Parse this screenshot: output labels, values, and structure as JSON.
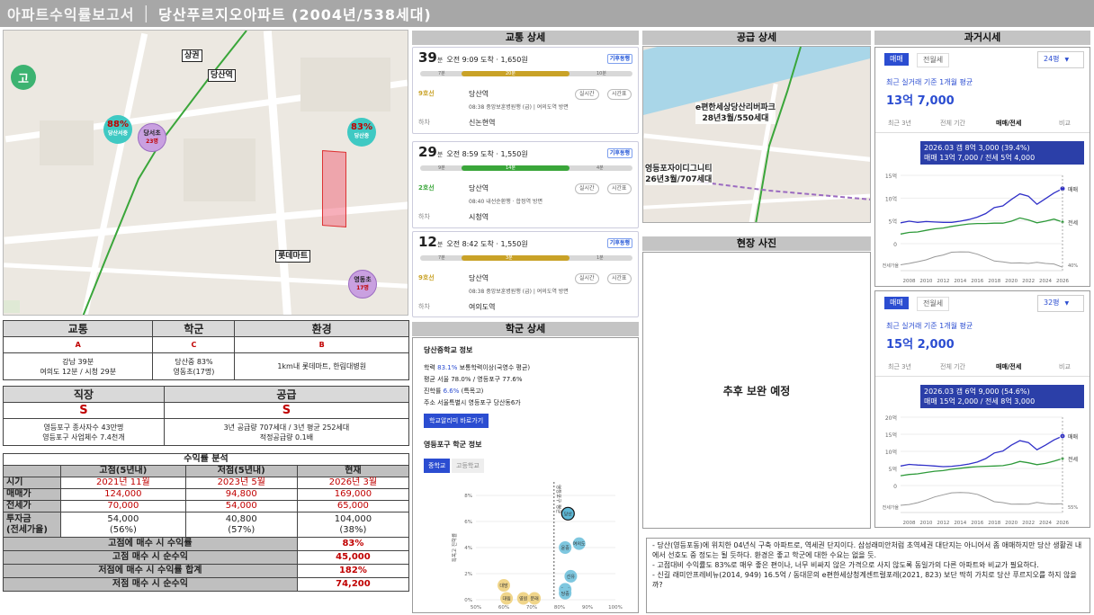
{
  "header": {
    "app": "아파트수익률보고서",
    "title": "당산푸르지오아파트 (2004년/538세대)"
  },
  "map": {
    "labels": {
      "school1": "고",
      "sangga": "상권",
      "station": "당산역",
      "mart": "롯데마트"
    },
    "schools": [
      {
        "pct": "88%",
        "name": "당산서중"
      },
      {
        "pct": "",
        "name": "당서초",
        "sub": "23명"
      },
      {
        "pct": "83%",
        "name": "당산중"
      },
      {
        "pct": "",
        "name": "영동초",
        "sub": "17명"
      }
    ]
  },
  "summary1": {
    "headers": [
      "교통",
      "학군",
      "환경"
    ],
    "grades": [
      "A",
      "C",
      "B"
    ],
    "details": [
      "강남 39분\n여의도 12분 / 시청 29분",
      "당산중 83%\n영동초(17명)",
      "1km내 롯데마트, 한림대병원"
    ]
  },
  "summary2": {
    "headers": [
      "직장",
      "공급"
    ],
    "grades": [
      "S",
      "S"
    ],
    "details": [
      "영등포구 종사자수 43만명\n영등포구 사업체수 7.4천개",
      "3년 공급량 707세대 / 3년 평균 252세대\n적정공급량 0.1배"
    ]
  },
  "profit": {
    "title": "수익률 분석",
    "cols": [
      "고점(5년내)",
      "저점(5년내)",
      "현재"
    ],
    "rows": [
      {
        "label": "시기",
        "vals": [
          "2021년 11월",
          "2023년 5월",
          "2026년 3월"
        ],
        "red": true
      },
      {
        "label": "매매가",
        "vals": [
          "124,000",
          "94,800",
          "169,000"
        ],
        "red": true
      },
      {
        "label": "전세가",
        "vals": [
          "70,000",
          "54,000",
          "65,000"
        ],
        "red": true
      },
      {
        "label": "투자금\n(전세가율)",
        "vals": [
          "54,000\n(56%)",
          "40,800\n(57%)",
          "104,000\n(38%)"
        ],
        "red": false
      }
    ],
    "summary": [
      {
        "label": "고점에 매수 시 수익률",
        "val": "83%"
      },
      {
        "label": "고점 매수 시 순수익",
        "val": "45,000"
      },
      {
        "label": "저점에 매수 시 수익률 합계",
        "val": "182%"
      },
      {
        "label": "저점 매수 시 순수익",
        "val": "74,200"
      }
    ]
  },
  "transit": {
    "title": "교통 상세",
    "routes": [
      {
        "min": "39",
        "unit": "분",
        "info": "오전 9:09 도착 · 1,650원",
        "badge": "기후동행",
        "bar": [
          "7분",
          "20분",
          "10분"
        ],
        "line": "9호선",
        "station": "당산역",
        "desc": "08:38 중앙보훈병원행 (급) | 여의도역 방면",
        "dest": "신논현역",
        "color": "#c9a227"
      },
      {
        "min": "29",
        "unit": "분",
        "info": "오전 8:59 도착 · 1,550원",
        "badge": "기후동행",
        "bar": [
          "9분",
          "14분",
          "4분"
        ],
        "line": "2호선",
        "station": "당산역",
        "desc": "08:40 내선순환행 · 합정역 방면",
        "dest": "시청역",
        "color": "#3aa63a"
      },
      {
        "min": "12",
        "unit": "분",
        "info": "오전 8:42 도착 · 1,550원",
        "badge": "기후동행",
        "bar": [
          "7분",
          "3분",
          "1분"
        ],
        "line": "9호선",
        "station": "당산역",
        "desc": "08:38 중앙보훈병원행 (급) | 여의도역 방면",
        "dest": "여의도역",
        "color": "#c9a227"
      }
    ],
    "pills": [
      "실시간",
      "시간표"
    ],
    "getoff": "하차"
  },
  "school": {
    "title": "학군 상세",
    "name": "당산중학교 정보",
    "lines": [
      {
        "k": "학력",
        "v": "83.1%",
        "rest": "보통학력이상(국영수 평균)"
      },
      {
        "k": "평균",
        "v": "서울 78.0% / 영등포구 77.6%",
        "rest": ""
      },
      {
        "k": "진학률",
        "v": "6.6%",
        "rest": "(특목고)"
      },
      {
        "k": "주소",
        "v": "서울특별시 영등포구 당산동6가",
        "rest": ""
      }
    ],
    "button": "학교알리미 바로가기",
    "subtitle": "영등포구 학군 정보",
    "tabs": [
      "중학교",
      "고등학교"
    ],
    "chart_data": {
      "type": "scatter",
      "x_ticks": [
        "50%",
        "60%",
        "70%",
        "80%",
        "90%",
        "100%"
      ],
      "y_ticks": [
        "8%",
        "6%",
        "4%",
        "2%",
        "0%"
      ],
      "xlim": [
        50,
        100
      ],
      "ylim": [
        0,
        8
      ],
      "xlabel": "학업성취도",
      "ylabel": "특목고 진학률",
      "vline_label": "영등포구 평균",
      "points": [
        {
          "name": "당산",
          "x": 83,
          "y": 6.6,
          "hl": true
        },
        {
          "name": "여의도",
          "x": 87,
          "y": 4.3,
          "hl": false
        },
        {
          "name": "윤중",
          "x": 82,
          "y": 4.0,
          "hl": false
        },
        {
          "name": "선유",
          "x": 84,
          "y": 1.8,
          "hl": false
        },
        {
          "name": "문래",
          "x": 82,
          "y": 0.8,
          "hl": false
        },
        {
          "name": "당중",
          "x": 82,
          "y": 0.5,
          "hl": false
        },
        {
          "name": "대방",
          "x": 60,
          "y": 1.1,
          "hl": false
        },
        {
          "name": "대림",
          "x": 61,
          "y": 0.1,
          "hl": false
        },
        {
          "name": "영원",
          "x": 67,
          "y": 0.1,
          "hl": false
        },
        {
          "name": "문래",
          "x": 71,
          "y": 0.1,
          "hl": false
        }
      ]
    }
  },
  "supply": {
    "title": "공급 상세",
    "labels": [
      "e편한세상당산리버파크\n28년3월/550세대",
      "영등포자이디그니티\n26년3월/707세대"
    ]
  },
  "photo": {
    "title": "현장 사진",
    "body": "추후 보완 예정"
  },
  "market": {
    "title": "과거시세",
    "panels": [
      {
        "tabs": [
          "매매",
          "전월세"
        ],
        "size": "24평",
        "avg_label": "최근 실거래 기준 1개월 평균",
        "avg": "13억 7,000",
        "periods": [
          "최근 3년",
          "전체 기간",
          "매매/전세",
          "비교"
        ],
        "tip1": "2026.03 갭 8억 3,000 (39.4%)",
        "tip2": "매매 13억 7,000 / 전세 5억 4,000",
        "chart_data": {
          "type": "line",
          "x": [
            2007,
            2008,
            2009,
            2010,
            2011,
            2012,
            2013,
            2014,
            2015,
            2016,
            2017,
            2018,
            2019,
            2020,
            2021,
            2022,
            2023,
            2024,
            2025,
            2026
          ],
          "x_ticks": [
            "2008",
            "2010",
            "2012",
            "2014",
            "2016",
            "2018",
            "2020",
            "2022",
            "2024",
            "2026"
          ],
          "y_ticks": [
            "15억",
            "10억",
            "5억",
            "0"
          ],
          "ylim": [
            0,
            17
          ],
          "series": [
            {
              "name": "매매",
              "values": [
                5.2,
                5.6,
                5.3,
                5.5,
                5.4,
                5.3,
                5.3,
                5.6,
                6.0,
                6.6,
                7.5,
                9.0,
                9.4,
                11.0,
                12.4,
                11.8,
                9.8,
                11.2,
                12.6,
                13.7
              ]
            },
            {
              "name": "전세",
              "values": [
                2.4,
                2.8,
                2.9,
                3.3,
                3.7,
                3.9,
                4.3,
                4.6,
                4.9,
                5.0,
                5.0,
                5.1,
                5.1,
                5.6,
                6.4,
                5.9,
                5.2,
                5.6,
                6.1,
                5.4
              ]
            }
          ],
          "ratio_label": "전세가율",
          "ratio_end": "40%"
        }
      },
      {
        "tabs": [
          "매매",
          "전월세"
        ],
        "size": "32평",
        "avg_label": "최근 실거래 기준 1개월 평균",
        "avg": "15억 2,000",
        "periods": [
          "최근 3년",
          "전체 기간",
          "매매/전세",
          "비교"
        ],
        "tip1": "2026.03 갭 6억 9,000 (54.6%)",
        "tip2": "매매 15억 2,000 / 전세 8억 3,000",
        "chart_data": {
          "type": "line",
          "x": [
            2007,
            2008,
            2009,
            2010,
            2011,
            2012,
            2013,
            2014,
            2015,
            2016,
            2017,
            2018,
            2019,
            2020,
            2021,
            2022,
            2023,
            2024,
            2025,
            2026
          ],
          "x_ticks": [
            "2008",
            "2010",
            "2012",
            "2014",
            "2016",
            "2018",
            "2020",
            "2022",
            "2024",
            "2026"
          ],
          "y_ticks": [
            "20억",
            "15억",
            "10억",
            "5억",
            "0"
          ],
          "ylim": [
            0,
            21
          ],
          "series": [
            {
              "name": "매매",
              "values": [
                6.0,
                6.5,
                6.3,
                6.2,
                6.0,
                5.8,
                5.9,
                6.2,
                6.6,
                7.2,
                8.3,
                10.0,
                10.6,
                12.4,
                13.8,
                13.2,
                11.0,
                12.4,
                14.0,
                15.2
              ]
            },
            {
              "name": "전세",
              "values": [
                3.0,
                3.4,
                3.6,
                4.0,
                4.4,
                4.6,
                5.0,
                5.3,
                5.6,
                5.8,
                5.9,
                6.0,
                6.1,
                6.6,
                7.4,
                7.0,
                6.4,
                6.8,
                7.5,
                8.3
              ]
            }
          ],
          "ratio_label": "전세가율",
          "ratio_end": "55%"
        }
      }
    ]
  },
  "notes": [
    "- 당산(영등포동)에 위치한 04년식 구축 아파트로, 역세권 단지이다. 삼성래미안처럼 초역세권 대단지는 아니어서 좀 애매하지만 당산 생활권 내에서 선호도 중 정도는 될 듯하다. 환경은 좋고 학군에 대한 수요는 없을 듯.",
    "- 고점대비 수익률도 83%로 매우 좋은 편이나, 너무 비싸지 않은 가격으로 사지 않도록 동일가의 다른 아파트와 비교가 필요하다.",
    "- 신길 래미안프레비뉴(2014, 949) 16.5억 / 동대문의 e편한세상청계센트럴포레(2021, 823) 보단 딱히 가치로 당산 푸르지오를 하지 않을까?"
  ]
}
